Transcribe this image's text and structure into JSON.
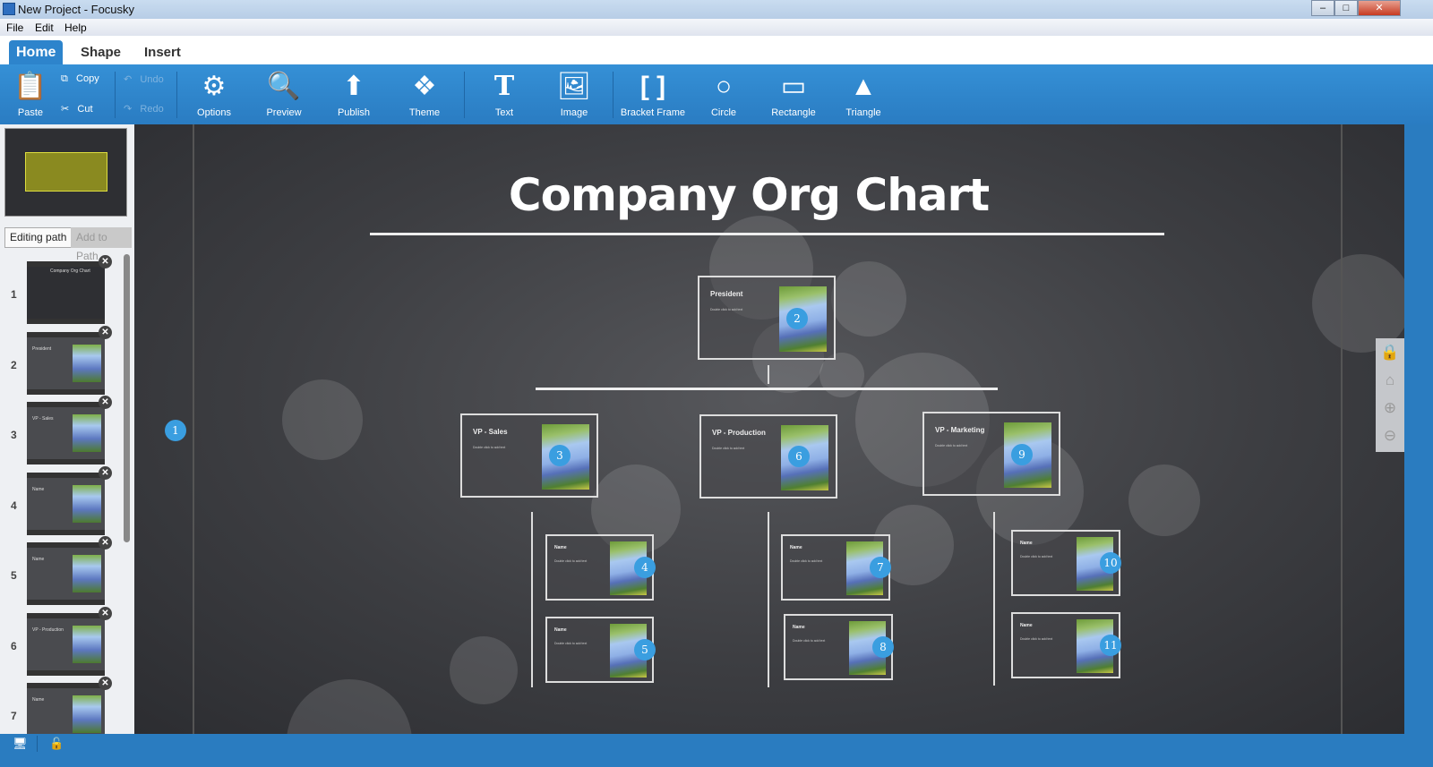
{
  "window": {
    "title": "New Project - Focusky",
    "controls": [
      "minimize",
      "maximize",
      "close"
    ]
  },
  "menu": [
    "File",
    "Edit",
    "Help"
  ],
  "tabs": [
    {
      "label": "Home",
      "active": true
    },
    {
      "label": "Shape"
    },
    {
      "label": "Insert"
    }
  ],
  "ribbon": {
    "paste": "Paste",
    "copy": "Copy",
    "cut": "Cut",
    "undo": "Undo",
    "redo": "Redo",
    "options": "Options",
    "preview": "Preview",
    "publish": "Publish",
    "theme": "Theme",
    "text": "Text",
    "image": "Image",
    "bracket": "Bracket Frame",
    "circle": "Circle",
    "rectangle": "Rectangle",
    "triangle": "Triangle"
  },
  "sidebar": {
    "editing_path": "Editing path",
    "add_to_path": "Add to Path",
    "thumbnails": [
      {
        "num": "1",
        "title": "Company Org Chart"
      },
      {
        "num": "2",
        "title": "President"
      },
      {
        "num": "3",
        "title": "VP - Sales"
      },
      {
        "num": "4",
        "title": "Name"
      },
      {
        "num": "5",
        "title": "Name"
      },
      {
        "num": "6",
        "title": "VP - Production"
      },
      {
        "num": "7",
        "title": "Name"
      }
    ]
  },
  "canvas": {
    "title": "Company Org Chart",
    "overview_marker": "1",
    "cards": [
      {
        "marker": "2",
        "title": "President",
        "subtitle": "Double click to add text"
      },
      {
        "marker": "3",
        "title": "VP - Sales",
        "subtitle": "Double click to add text"
      },
      {
        "marker": "4",
        "title": "Name",
        "subtitle": "Double click to add text"
      },
      {
        "marker": "5",
        "title": "Name",
        "subtitle": "Double click to add text"
      },
      {
        "marker": "6",
        "title": "VP - Production",
        "subtitle": "Double click to add text"
      },
      {
        "marker": "7",
        "title": "Name",
        "subtitle": "Double click to add text"
      },
      {
        "marker": "8",
        "title": "Name",
        "subtitle": "Double click to add text"
      },
      {
        "marker": "9",
        "title": "VP - Marketing",
        "subtitle": "Double click to add text"
      },
      {
        "marker": "10",
        "title": "Name",
        "subtitle": "Double click to add text"
      },
      {
        "marker": "11",
        "title": "Name",
        "subtitle": "Double click to add text"
      }
    ]
  },
  "right_tools": [
    "lock-icon",
    "home-icon",
    "zoom-in-icon",
    "zoom-out-icon"
  ],
  "colors": {
    "ribbon": "#2d84cc",
    "marker": "#3a9ee0",
    "canvas": "#3d3e42"
  }
}
